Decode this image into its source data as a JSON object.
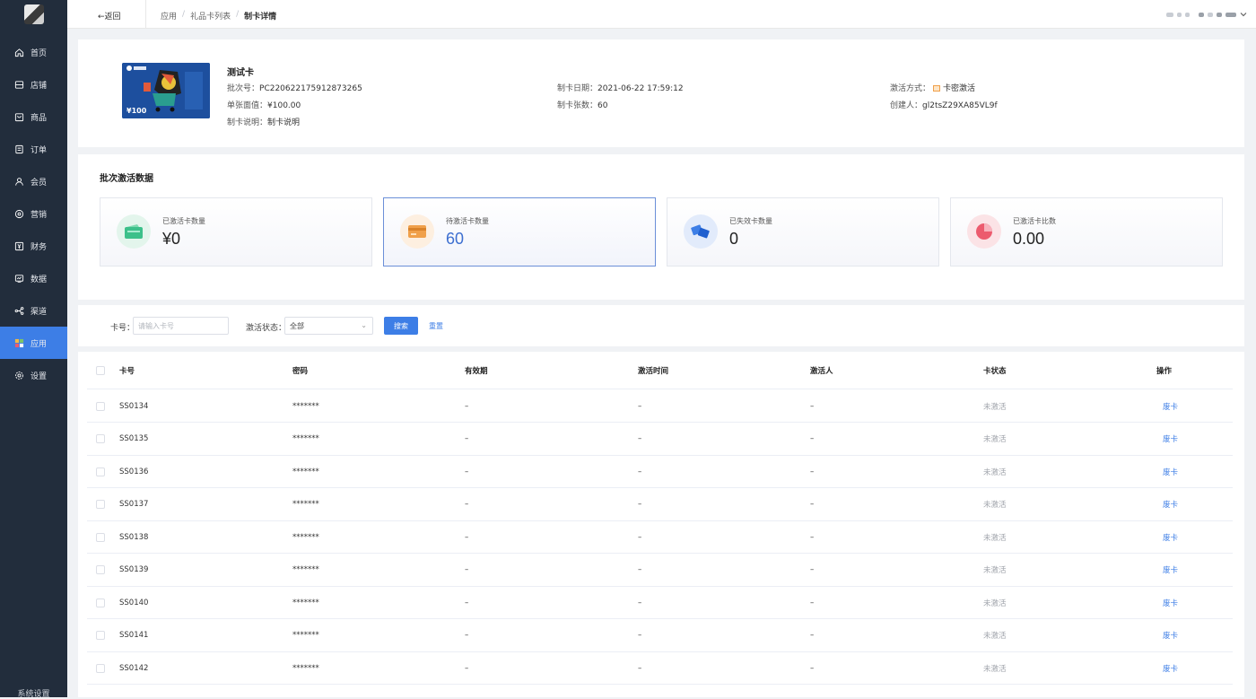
{
  "sidebar": {
    "items": [
      {
        "label": "首页",
        "icon": "home-icon"
      },
      {
        "label": "店铺",
        "icon": "store-icon"
      },
      {
        "label": "商品",
        "icon": "bag-icon"
      },
      {
        "label": "订单",
        "icon": "order-icon"
      },
      {
        "label": "会员",
        "icon": "user-icon"
      },
      {
        "label": "营销",
        "icon": "marketing-icon"
      },
      {
        "label": "财务",
        "icon": "finance-icon"
      },
      {
        "label": "数据",
        "icon": "data-icon"
      },
      {
        "label": "渠道",
        "icon": "channel-icon"
      },
      {
        "label": "应用",
        "icon": "apps-icon"
      },
      {
        "label": "设置",
        "icon": "gear-icon"
      }
    ],
    "active_index": 9,
    "footer": "系统设置"
  },
  "header": {
    "back_label": "←返回",
    "breadcrumb": [
      "应用",
      "礼品卡列表",
      "制卡详情"
    ]
  },
  "card_info": {
    "title": "测试卡",
    "image_price": "¥100",
    "batch_label": "批次号：",
    "batch_value": "PC220622175912873265",
    "face_label": "单张面值：",
    "face_value": "¥100.00",
    "desc_label": "制卡说明：",
    "desc_value": "制卡说明",
    "date_label": "制卡日期：",
    "date_value": "2021-06-22 17:59:12",
    "count_label": "制卡张数：",
    "count_value": "60",
    "method_label": "激活方式：",
    "method_value": "卡密激活",
    "creator_label": "创建人：",
    "creator_value": "gl2tsZ29XA85VL9f"
  },
  "stats": {
    "title": "批次激活数据",
    "cards": [
      {
        "label": "已激活卡数量",
        "value": "¥0",
        "icon": "wallet-icon",
        "color": "#3cc08a"
      },
      {
        "label": "待激活卡数量",
        "value": "60",
        "icon": "card-icon",
        "color": "#f0a04a",
        "selected": true
      },
      {
        "label": "已失效卡数量",
        "value": "0",
        "icon": "expired-cards-icon",
        "color": "#3d7ee6"
      },
      {
        "label": "已激活卡比数",
        "value": "0.00",
        "icon": "pie-chart-icon",
        "color": "#ec5b6e"
      }
    ]
  },
  "filter": {
    "card_no_label": "卡号：",
    "card_no_placeholder": "请输入卡号",
    "status_label": "激活状态：",
    "status_value": "全部",
    "search_label": "搜索",
    "reset_label": "重置"
  },
  "table": {
    "columns": [
      "卡号",
      "密码",
      "有效期",
      "激活时间",
      "激活人",
      "卡状态",
      "操作"
    ],
    "rows": [
      {
        "card_no": "SS0134",
        "password": "*******",
        "validity": "–",
        "activated_at": "–",
        "activator": "–",
        "status": "未激活",
        "action": "废卡"
      },
      {
        "card_no": "SS0135",
        "password": "*******",
        "validity": "–",
        "activated_at": "–",
        "activator": "–",
        "status": "未激活",
        "action": "废卡"
      },
      {
        "card_no": "SS0136",
        "password": "*******",
        "validity": "–",
        "activated_at": "–",
        "activator": "–",
        "status": "未激活",
        "action": "废卡"
      },
      {
        "card_no": "SS0137",
        "password": "*******",
        "validity": "–",
        "activated_at": "–",
        "activator": "–",
        "status": "未激活",
        "action": "废卡"
      },
      {
        "card_no": "SS0138",
        "password": "*******",
        "validity": "–",
        "activated_at": "–",
        "activator": "–",
        "status": "未激活",
        "action": "废卡"
      },
      {
        "card_no": "SS0139",
        "password": "*******",
        "validity": "–",
        "activated_at": "–",
        "activator": "–",
        "status": "未激活",
        "action": "废卡"
      },
      {
        "card_no": "SS0140",
        "password": "*******",
        "validity": "–",
        "activated_at": "–",
        "activator": "–",
        "status": "未激活",
        "action": "废卡"
      },
      {
        "card_no": "SS0141",
        "password": "*******",
        "validity": "–",
        "activated_at": "–",
        "activator": "–",
        "status": "未激活",
        "action": "废卡"
      },
      {
        "card_no": "SS0142",
        "password": "*******",
        "validity": "–",
        "activated_at": "–",
        "activator": "–",
        "status": "未激活",
        "action": "废卡"
      }
    ]
  }
}
